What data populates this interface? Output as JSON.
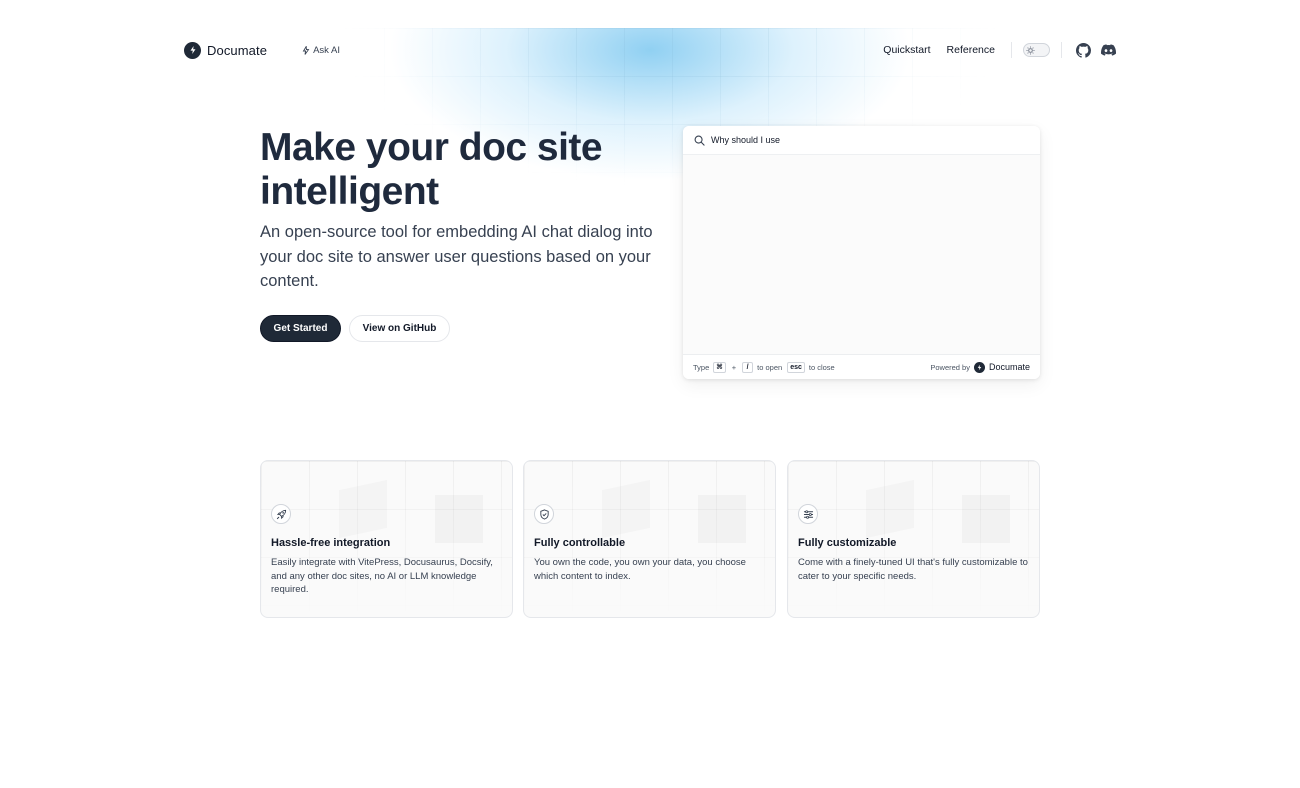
{
  "nav": {
    "brand": "Documate",
    "ask_ai": "Ask AI",
    "links": {
      "quickstart": "Quickstart",
      "reference": "Reference"
    },
    "icons": [
      "sun-icon",
      "github-icon",
      "discord-icon"
    ]
  },
  "hero": {
    "title": "Make your doc site intelligent",
    "subtitle": "An open-source tool for embedding AI chat dialog into your doc site to answer user questions based on your content.",
    "primary_button": "Get Started",
    "secondary_button": "View on GitHub"
  },
  "dialog": {
    "input_value": "Why should I use",
    "footer": {
      "type_label": "Type",
      "key_cmd": "⌘",
      "plus": "+",
      "key_slash": "/",
      "to_open": "to open",
      "key_esc": "esc",
      "to_close": "to close",
      "powered_by": "Powered by",
      "brand": "Documate"
    }
  },
  "features": [
    {
      "icon": "rocket-icon",
      "title": "Hassle-free integration",
      "text": "Easily integrate with VitePress, Docusaurus, Docsify, and any other doc sites, no AI or LLM knowledge required."
    },
    {
      "icon": "shield-check-icon",
      "title": "Fully controllable",
      "text": "You own the code, you own your data, you choose which content to index."
    },
    {
      "icon": "sliders-icon",
      "title": "Fully customizable",
      "text": "Come with a finely-tuned UI that's fully customizable to cater to your specific needs."
    }
  ],
  "colors": {
    "primary": "#1f2937",
    "accent_glow": "#7dc8f0",
    "text": "#374151",
    "border": "#e5e7eb"
  }
}
